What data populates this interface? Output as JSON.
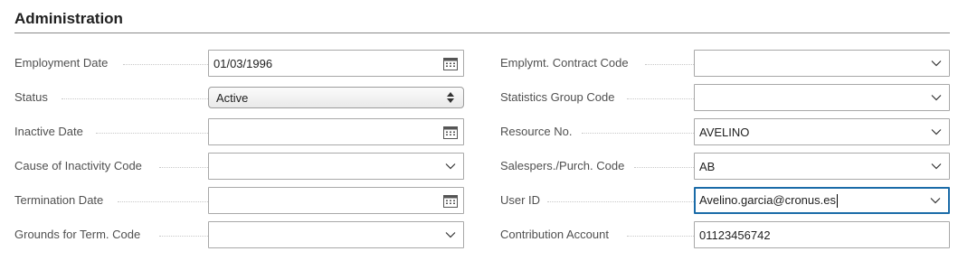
{
  "section": {
    "title": "Administration"
  },
  "left": [
    {
      "label": "Employment Date",
      "value": "01/03/1996",
      "kind": "date"
    },
    {
      "label": "Status",
      "value": "Active",
      "kind": "select"
    },
    {
      "label": "Inactive Date",
      "value": "",
      "kind": "date"
    },
    {
      "label": "Cause of Inactivity Code",
      "value": "",
      "kind": "dropdown"
    },
    {
      "label": "Termination Date",
      "value": "",
      "kind": "date"
    },
    {
      "label": "Grounds for Term. Code",
      "value": "",
      "kind": "dropdown"
    }
  ],
  "right": [
    {
      "label": "Emplymt. Contract Code",
      "value": "",
      "kind": "dropdown"
    },
    {
      "label": "Statistics Group Code",
      "value": "",
      "kind": "dropdown"
    },
    {
      "label": "Resource No.",
      "value": "AVELINO",
      "kind": "dropdown"
    },
    {
      "label": "Salespers./Purch. Code",
      "value": "AB",
      "kind": "dropdown"
    },
    {
      "label": "User ID",
      "value": "Avelino.garcia@cronus.es",
      "kind": "dropdown"
    },
    {
      "label": "Contribution Account",
      "value": "01123456742",
      "kind": "text"
    }
  ],
  "icons": {
    "date": "calendar-icon",
    "dropdown": "chevron-down-icon",
    "select": "updown-arrows-icon"
  }
}
